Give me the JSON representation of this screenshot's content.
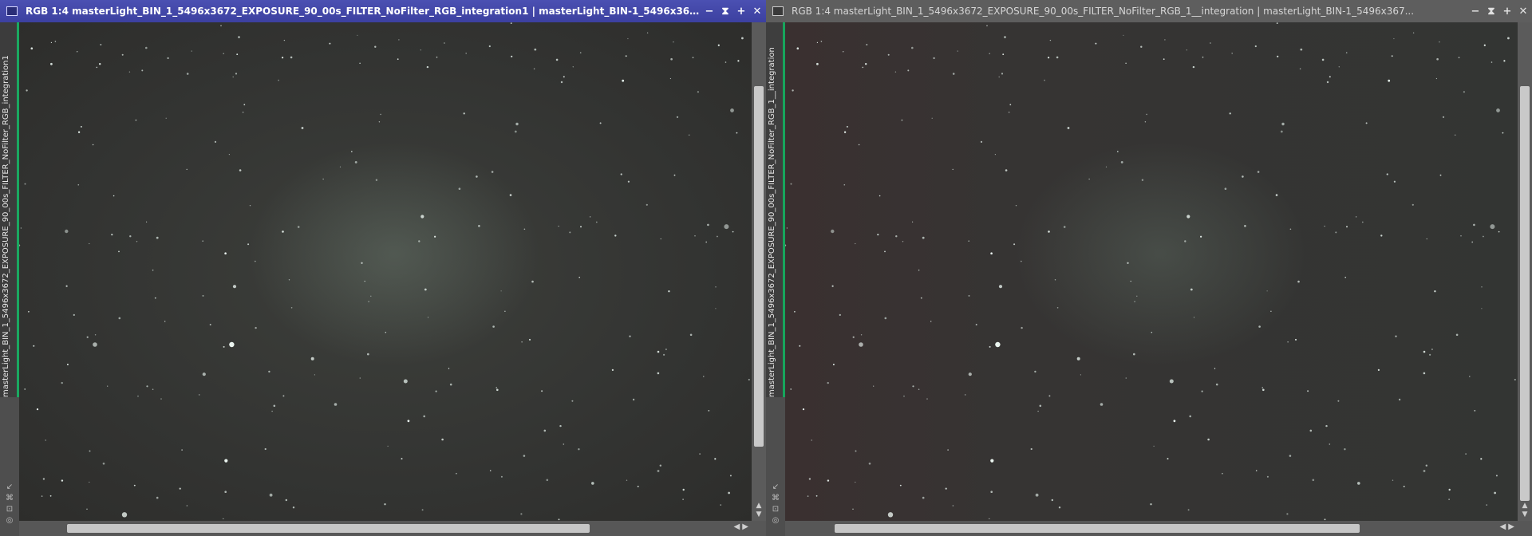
{
  "windows": [
    {
      "id": "left",
      "title": "RGB 1:4 masterLight_BIN_1_5496x3672_EXPOSURE_90_00s_FILTER_NoFilter_RGB_integration1 | masterLight_BIN-1_5496x3672_...",
      "tab_label": "masterLight_BIN_1_5496x3672_EXPOSURE_90_00s_FILTER_NoFilter_RGB_integration1",
      "active": true
    },
    {
      "id": "right",
      "title": "RGB 1:4 masterLight_BIN_1_5496x3672_EXPOSURE_90_00s_FILTER_NoFilter_RGB_1__integration | masterLight_BIN-1_5496x367...",
      "tab_label": "masterLight_BIN_1_5496x3672_EXPOSURE_90_00s_FILTER_NoFilter_RGB_1__integration",
      "active": false
    }
  ],
  "titlebar_buttons": {
    "minimize": "−",
    "shade": "⧗",
    "maximize": "+",
    "close": "✕"
  },
  "side_icons": [
    "↙",
    "⌘",
    "⊡",
    "◎"
  ],
  "colors": {
    "active_title": "#3c40a0",
    "tab_accent": "#1aa860",
    "background": "#4a4a4a"
  }
}
